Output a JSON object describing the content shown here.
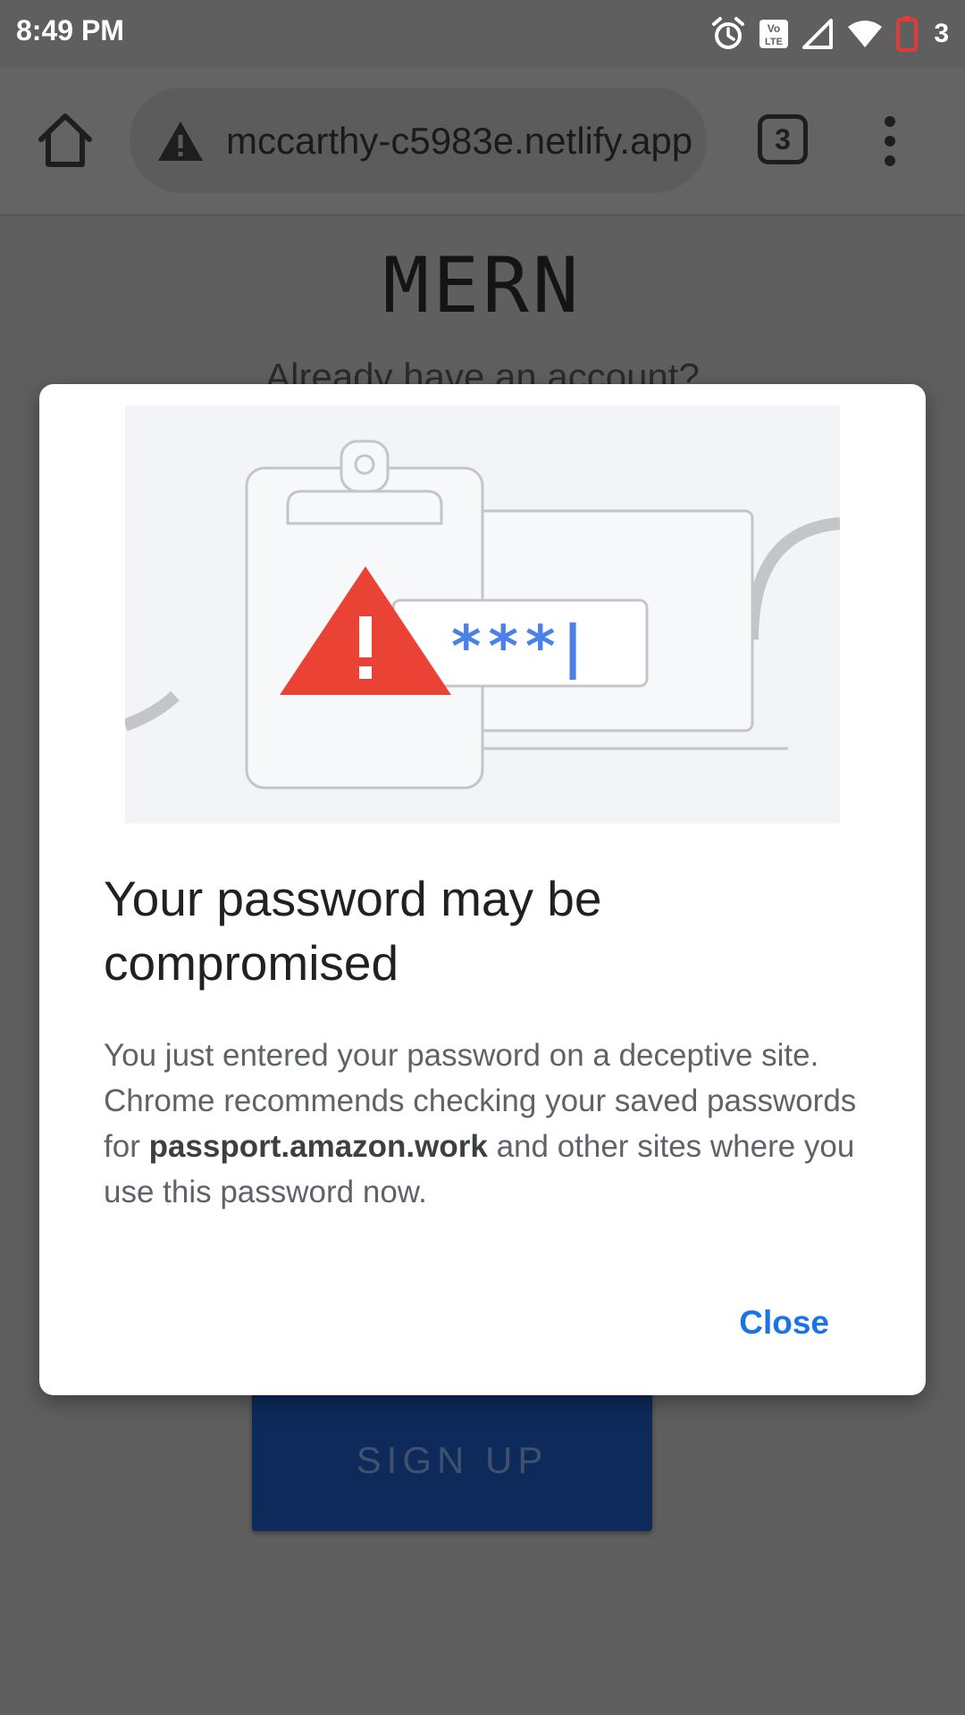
{
  "status_bar": {
    "time": "8:49 PM",
    "battery_number": "3",
    "icons": [
      "alarm-icon",
      "volte-icon",
      "signal-icon",
      "wifi-icon",
      "battery-low-icon"
    ]
  },
  "browser": {
    "url": "mccarthy-c5983e.netlify.app",
    "tab_count": "3"
  },
  "page": {
    "title": "MERN",
    "subtitle": "Already have an account?",
    "signup_label": "SIGN UP"
  },
  "dialog": {
    "title": "Your password may be compromised",
    "body_before": "You just entered your password on a deceptive site. Chrome recommends checking your saved passwords for ",
    "body_domain": "passport.amazon.work",
    "body_after": " and other sites where you use this password now.",
    "close_label": "Close",
    "illustration_password": "***|"
  },
  "colors": {
    "accent": "#1a73e8",
    "warning": "#ea4335",
    "scrim": "#5f5f5f",
    "signup_button": "#0e2a5a"
  }
}
